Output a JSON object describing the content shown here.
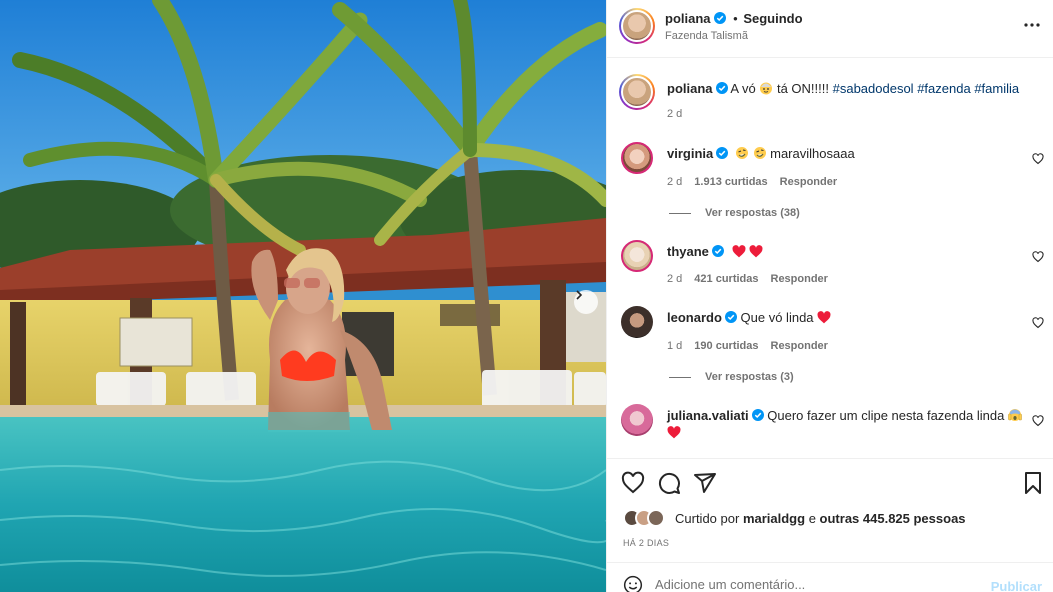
{
  "post": {
    "author": "poliana",
    "follow_status": "Seguindo",
    "dot": "•",
    "location": "Fazenda Talismã",
    "more_icon": "more-horizontal-icon",
    "caption": {
      "username": "poliana",
      "text_before": "A vó",
      "text_after": "tá ON!!!!!",
      "hashtags": [
        "#sabadodesol",
        "#fazenda",
        "#familia"
      ],
      "time": "2 d"
    }
  },
  "comments": [
    {
      "username": "virginia",
      "text": "maravilhosaaa",
      "time": "2 d",
      "likes": "1.913 curtidas",
      "reply": "Responder",
      "view_replies": "Ver respostas (38)"
    },
    {
      "username": "thyane",
      "text": "",
      "time": "2 d",
      "likes": "421 curtidas",
      "reply": "Responder"
    },
    {
      "username": "leonardo",
      "text": "Que vó linda",
      "time": "1 d",
      "likes": "190 curtidas",
      "reply": "Responder",
      "view_replies": "Ver respostas (3)"
    },
    {
      "username": "juliana.valiati",
      "text": "Quero fazer um clipe nesta fazenda linda"
    }
  ],
  "actions": {
    "liked_by_prefix": "Curtido por",
    "liked_by_user": "marialdgg",
    "liked_by_mid": "e",
    "liked_by_others": "outras 445.825 pessoas",
    "time_ago": "HÁ 2 DIAS"
  },
  "add_comment": {
    "placeholder": "Adicione um comentário...",
    "publish": "Publicar"
  },
  "colors": {
    "accent_link": "#00376b",
    "verified_blue": "#0095f6",
    "publish_disabled": "#b2dffc",
    "heart_red": "#ed1c3a"
  }
}
